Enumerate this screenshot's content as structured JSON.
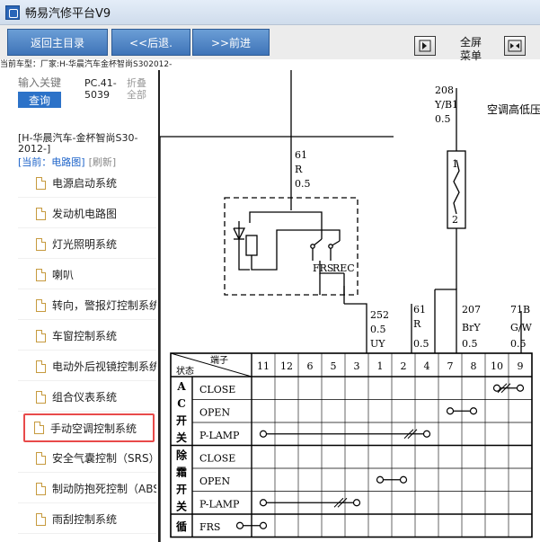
{
  "app": {
    "title": "畅易汽修平台V9"
  },
  "toolbar": {
    "back_main": "返回主目录",
    "back": "<<后退.",
    "forward": ">>前进",
    "fullscreen_line1": "全屏",
    "fullscreen_line2": "菜单"
  },
  "vehicle_bar": {
    "text": "当前车型：厂家:H-华晨汽车金杯智尚S302012-"
  },
  "sidebar": {
    "search_placeholder": "输入关键",
    "query_button": "查询",
    "code": "PC.41-5039",
    "collapse_all": "折叠全部",
    "vehicle_name": "[H-华晨汽车-金杯智尚S30-2012-]",
    "current_label": "[当前：电路图]",
    "refresh": "[刷新]",
    "items": [
      {
        "label": "电源启动系统"
      },
      {
        "label": "发动机电路图"
      },
      {
        "label": "灯光照明系统"
      },
      {
        "label": "喇叭"
      },
      {
        "label": "转向，警报灯控制系统"
      },
      {
        "label": "车窗控制系统"
      },
      {
        "label": "电动外后视镜控制系统"
      },
      {
        "label": "组合仪表系统"
      },
      {
        "label": "手动空调控制系统"
      },
      {
        "label": "安全气囊控制（SRS）"
      },
      {
        "label": "制动防抱死控制（ABS）"
      },
      {
        "label": "雨刮控制系统"
      }
    ],
    "active_index": 8
  },
  "diagram": {
    "switch_title": "空调高低压开关",
    "wires": {
      "w208": [
        "208",
        "Y/B1",
        "0.5"
      ],
      "w61a": [
        "61",
        "R",
        "0.5"
      ],
      "w252": [
        "252",
        "0.5",
        "UY"
      ],
      "w61b": [
        "61",
        "R",
        "0.5"
      ],
      "w207": [
        "207",
        "BrY",
        "0.5"
      ],
      "w71b": [
        "71B",
        "G/W",
        "0.5"
      ]
    },
    "relay_labels": {
      "frs": "FRS",
      "rec": "REC"
    },
    "switch_pins": {
      "p1": "1",
      "p2": "2"
    },
    "table": {
      "header_terminal": "端子",
      "header_state": "状态",
      "terminals": [
        "11",
        "12",
        "6",
        "5",
        "3",
        "1",
        "2",
        "4",
        "7",
        "8",
        "10",
        "9"
      ],
      "groups": [
        {
          "name": "AC开关",
          "rows": [
            "CLOSE",
            "OPEN",
            "P-LAMP"
          ]
        },
        {
          "name": "除霜开关",
          "rows": [
            "CLOSE",
            "OPEN",
            "P-LAMP"
          ]
        },
        {
          "name": "循",
          "rows": [
            "FRS"
          ]
        }
      ]
    }
  }
}
